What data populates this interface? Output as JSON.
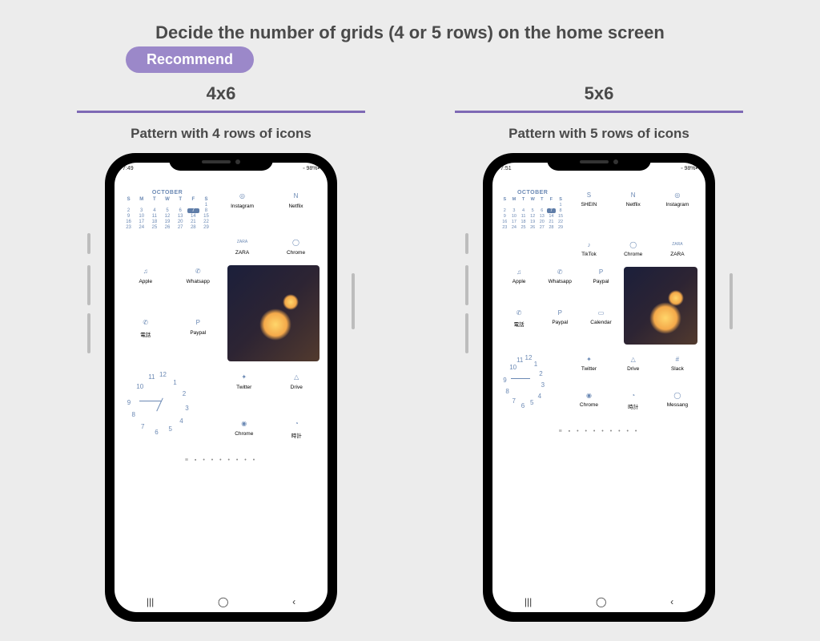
{
  "title": "Decide the number of grids (4 or 5 rows) on the home screen",
  "recommend": "Recommend",
  "left": {
    "grid": "4x6",
    "pattern": "Pattern with 4 rows of icons",
    "status": {
      "time": "7:49",
      "battery": "98%"
    },
    "calendar": {
      "month": "OCTOBER",
      "dow": [
        "S",
        "M",
        "T",
        "W",
        "T",
        "F",
        "S"
      ],
      "weeks": [
        [
          "",
          "",
          "",
          "",
          "",
          "",
          "1"
        ],
        [
          "2",
          "3",
          "4",
          "5",
          "6",
          "7",
          "8"
        ],
        [
          "9",
          "10",
          "11",
          "12",
          "13",
          "14",
          "15"
        ],
        [
          "16",
          "17",
          "18",
          "19",
          "20",
          "21",
          "22"
        ],
        [
          "23",
          "24",
          "25",
          "26",
          "27",
          "28",
          "29"
        ]
      ],
      "today": "7"
    },
    "apps_top": [
      {
        "name": "Instagram",
        "glyph": "◎"
      },
      {
        "name": "Netflix",
        "glyph": "N"
      },
      {
        "name": "ZARA",
        "glyph": "ZARA"
      },
      {
        "name": "Chrome",
        "glyph": "◯"
      }
    ],
    "apps_mid_left": [
      {
        "name": "Apple",
        "glyph": "♫"
      },
      {
        "name": "Whatsapp",
        "glyph": "✆"
      },
      {
        "name": "電話",
        "glyph": "✆"
      },
      {
        "name": "Paypal",
        "glyph": "P"
      }
    ],
    "apps_bot": [
      {
        "name": "Twitter",
        "glyph": "✦"
      },
      {
        "name": "Drive",
        "glyph": "△"
      },
      {
        "name": "Chrome",
        "glyph": "◉"
      },
      {
        "name": "時計",
        "glyph": "◔"
      }
    ],
    "dots": "≡ ▪ • • • • • • •",
    "nav": [
      "|||",
      "◯",
      "‹"
    ]
  },
  "right": {
    "grid": "5x6",
    "pattern": "Pattern with 5 rows of icons",
    "status": {
      "time": "7:51",
      "battery": "98%"
    },
    "calendar": {
      "month": "OCTOBER",
      "dow": [
        "S",
        "M",
        "T",
        "W",
        "T",
        "F",
        "S"
      ],
      "weeks": [
        [
          "",
          "",
          "",
          "",
          "",
          "",
          "1"
        ],
        [
          "2",
          "3",
          "4",
          "5",
          "6",
          "7",
          "8"
        ],
        [
          "9",
          "10",
          "11",
          "12",
          "13",
          "14",
          "15"
        ],
        [
          "16",
          "17",
          "18",
          "19",
          "20",
          "21",
          "22"
        ],
        [
          "23",
          "24",
          "25",
          "26",
          "27",
          "28",
          "29"
        ]
      ],
      "today": "7"
    },
    "row1_apps": [
      {
        "name": "SHEIN",
        "glyph": "S"
      },
      {
        "name": "Netflix",
        "glyph": "N"
      },
      {
        "name": "Instagram",
        "glyph": "◎"
      }
    ],
    "row2_apps": [
      {
        "name": "TikTok",
        "glyph": "♪"
      },
      {
        "name": "Chrome",
        "glyph": "◯"
      },
      {
        "name": "ZARA",
        "glyph": "ZARA"
      }
    ],
    "mid_apps": [
      {
        "name": "Apple",
        "glyph": "♫"
      },
      {
        "name": "Whatsapp",
        "glyph": "✆"
      },
      {
        "name": "Paypal",
        "glyph": "P"
      },
      {
        "name": "電話",
        "glyph": "✆"
      },
      {
        "name": "Paypal",
        "glyph": "P"
      },
      {
        "name": "Calendar",
        "glyph": "▭"
      }
    ],
    "bot_apps": [
      {
        "name": "Twitter",
        "glyph": "✦"
      },
      {
        "name": "Drive",
        "glyph": "△"
      },
      {
        "name": "Slack",
        "glyph": "#"
      },
      {
        "name": "Chrome",
        "glyph": "◉"
      },
      {
        "name": "時計",
        "glyph": "◔"
      },
      {
        "name": "Messang",
        "glyph": "◯"
      }
    ],
    "dots": "≡ ▪ • • • • • • • •",
    "nav": [
      "|||",
      "◯",
      "‹"
    ]
  }
}
